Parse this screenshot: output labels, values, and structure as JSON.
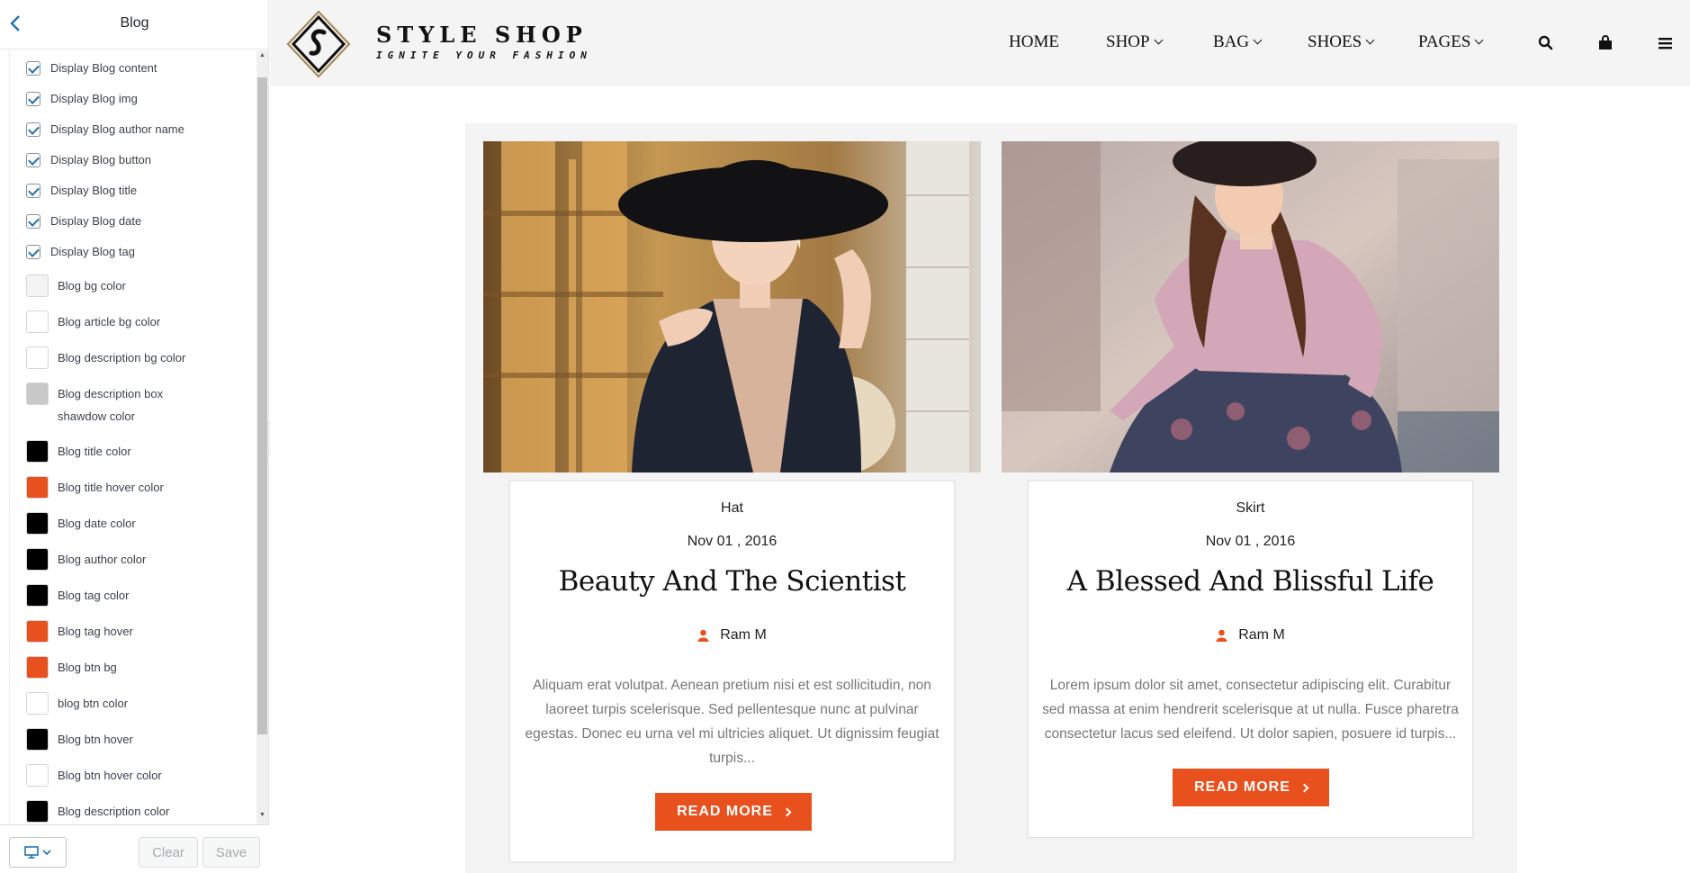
{
  "panel": {
    "title": "Blog",
    "checkboxes": [
      {
        "label": "Display Blog content",
        "checked": true
      },
      {
        "label": "Display Blog img",
        "checked": true
      },
      {
        "label": "Display Blog author name",
        "checked": true
      },
      {
        "label": "Display Blog button",
        "checked": true
      },
      {
        "label": "Display Blog title",
        "checked": true
      },
      {
        "label": "Display Blog date",
        "checked": true
      },
      {
        "label": "Display Blog tag",
        "checked": true
      }
    ],
    "colors": [
      {
        "label": "Blog bg color",
        "color": "#f4f4f4"
      },
      {
        "label": "Blog article bg color",
        "color": "#ffffff"
      },
      {
        "label": "Blog description bg color",
        "color": "#ffffff"
      },
      {
        "label": "Blog description box",
        "label2": "shawdow color",
        "color": "#c8c8c8"
      },
      {
        "label": "Blog title color",
        "color": "#000000"
      },
      {
        "label": "Blog title hover color",
        "color": "#e8501e"
      },
      {
        "label": "Blog date color",
        "color": "#000000"
      },
      {
        "label": "Blog author color",
        "color": "#000000"
      },
      {
        "label": "Blog tag color",
        "color": "#000000"
      },
      {
        "label": "Blog tag hover",
        "color": "#e8501e"
      },
      {
        "label": "Blog btn bg",
        "color": "#e8501e"
      },
      {
        "label": "blog btn color",
        "color": "#ffffff"
      },
      {
        "label": "Blog btn hover",
        "color": "#000000"
      },
      {
        "label": "Blog btn hover color",
        "color": "#ffffff"
      },
      {
        "label": "Blog description color",
        "color": "#000000"
      }
    ],
    "footer": {
      "clear_label": "Clear",
      "save_label": "Save",
      "device_icon": "desktop-icon"
    }
  },
  "site": {
    "brand_name": "STYLE SHOP",
    "brand_tagline": "IGNITE YOUR FASHION",
    "nav": [
      {
        "label": "HOME",
        "dropdown": false
      },
      {
        "label": "SHOP",
        "dropdown": true
      },
      {
        "label": "BAG",
        "dropdown": true
      },
      {
        "label": "SHOES",
        "dropdown": true
      },
      {
        "label": "PAGES",
        "dropdown": true
      }
    ],
    "nav_icons": [
      "search-icon",
      "bag-icon",
      "menu-icon"
    ],
    "accent_color": "#e8501e",
    "posts": [
      {
        "tag": "Hat",
        "date": "Nov 01 , 2016",
        "title": "Beauty And The Scientist",
        "author": "Ram M",
        "description": "Aliquam erat volutpat. Aenean pretium nisi et est sollicitudin, non laoreet turpis scelerisque. Sed pellentesque nunc at pulvinar egestas. Donec eu urna vel mi ultricies aliquet. Ut dignissim feugiat turpis...",
        "button": "READ MORE"
      },
      {
        "tag": "Skirt",
        "date": "Nov 01 , 2016",
        "title": "A Blessed And Blissful Life",
        "author": "Ram M",
        "description": "Lorem ipsum dolor sit amet, consectetur adipiscing elit. Curabitur sed massa at enim hendrerit scelerisque at ut nulla. Fusce pharetra consectetur lacus sed eleifend. Ut dolor sapien, posuere id turpis...",
        "button": "READ MORE"
      }
    ]
  }
}
